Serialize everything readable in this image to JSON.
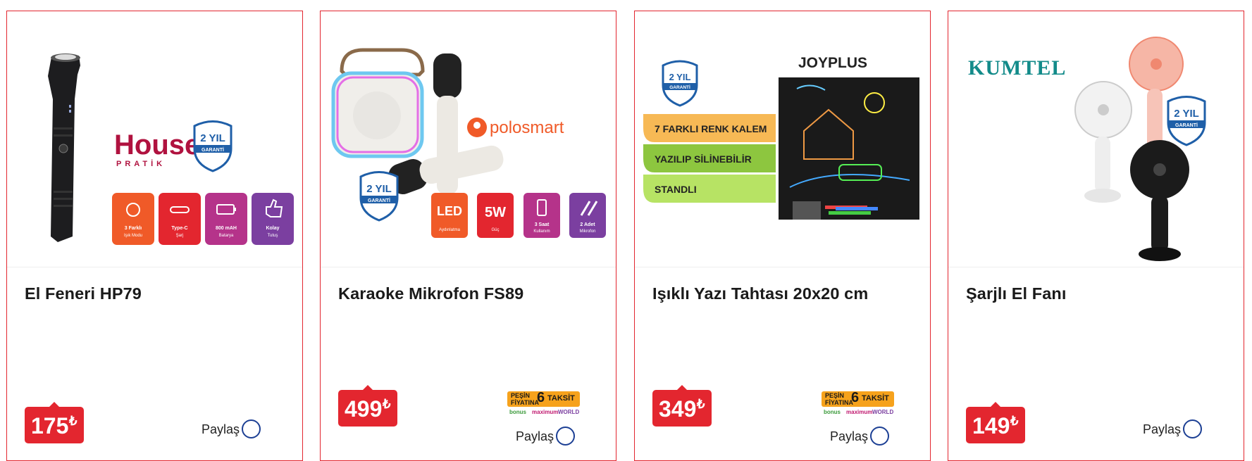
{
  "products": [
    {
      "title": "El Feneri HP79",
      "price": "175",
      "currency": "₺",
      "share_label": "Paylaş",
      "has_installment": false,
      "brand": "House",
      "brand_sub": "PRATİK",
      "warranty_years": "2 YIL",
      "warranty_word": "GARANTİ",
      "features": [
        {
          "title": "3 Farklı",
          "sub": "Işık Modu",
          "color": "#f05a28",
          "icon": "sun-icon"
        },
        {
          "title": "Type-C",
          "sub": "Şarj",
          "color": "#e3262f",
          "icon": "usb-icon"
        },
        {
          "title": "800 mAH",
          "sub": "Batarya",
          "color": "#b5338a",
          "icon": "battery-icon"
        },
        {
          "title": "Kolay",
          "sub": "Tutuş",
          "color": "#7b3fa0",
          "icon": "thumb-icon"
        }
      ]
    },
    {
      "title": "Karaoke Mikrofon FS89",
      "price": "499",
      "currency": "₺",
      "share_label": "Paylaş",
      "has_installment": true,
      "brand": "polosmart",
      "warranty_years": "2 YIL",
      "warranty_word": "GARANTİ",
      "features": [
        {
          "title": "LED",
          "sub": "Aydınlatma",
          "color": "#f05a28",
          "icon": "led-icon"
        },
        {
          "title": "5W",
          "sub": "Güç",
          "color": "#e3262f",
          "icon": "power-icon"
        },
        {
          "title": "3 Saat",
          "sub": "Kullanım",
          "color": "#b5338a",
          "icon": "battery-icon"
        },
        {
          "title": "2 Adet",
          "sub": "Mikrofon",
          "color": "#7b3fa0",
          "icon": "mic-icon"
        }
      ]
    },
    {
      "title": "Işıklı Yazı Tahtası 20x20 cm",
      "price": "349",
      "currency": "₺",
      "share_label": "Paylaş",
      "has_installment": true,
      "brand": "JOYPLUS",
      "warranty_years": "2 YIL",
      "warranty_word": "GARANTİ",
      "ribbons": [
        {
          "text": "7 FARKLI RENK KALEM",
          "color": "#f7b955"
        },
        {
          "text": "YAZILIP SİLİNEBİLİR",
          "color": "#8dc63f"
        },
        {
          "text": "STANDLI",
          "color": "#b7e364"
        }
      ]
    },
    {
      "title": "Şarjlı El Fanı",
      "price": "149",
      "currency": "₺",
      "share_label": "Paylaş",
      "has_installment": false,
      "brand": "KUMTEL",
      "warranty_years": "2 YIL",
      "warranty_word": "GARANTİ"
    }
  ],
  "installment": {
    "pesin": "PEŞİN",
    "fiyatina": "FİYATINA",
    "count": "6",
    "taksit": "TAKSİT",
    "banks": [
      "bonus",
      "maximum",
      "WORLD"
    ]
  },
  "colors": {
    "accent": "#e3262f",
    "share_circle": "#1c3f94",
    "installment_bg": "#f6a21c"
  }
}
